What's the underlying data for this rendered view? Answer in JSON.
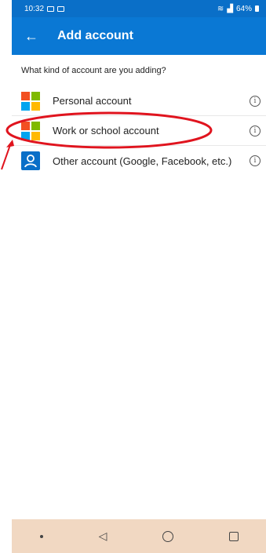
{
  "status_bar": {
    "time": "10:32",
    "battery": "64%"
  },
  "app_bar": {
    "title": "Add account",
    "back_icon": "arrow-left-icon"
  },
  "question": "What kind of account are you adding?",
  "accounts": [
    {
      "label": "Personal account",
      "logo": "microsoft-logo",
      "info_icon": "info-icon"
    },
    {
      "label": "Work or school account",
      "logo": "microsoft-logo",
      "info_icon": "info-icon"
    },
    {
      "label": "Other account (Google, Facebook, etc.)",
      "logo": "person-icon",
      "info_icon": "info-icon"
    }
  ],
  "colors": {
    "app_bar": "#0a78d4",
    "highlight": "#e0141e",
    "nav_bar": "#f1d8c2",
    "ms_red": "#f25022",
    "ms_green": "#7fba00",
    "ms_blue": "#00a4ef",
    "ms_yellow": "#ffb900"
  }
}
